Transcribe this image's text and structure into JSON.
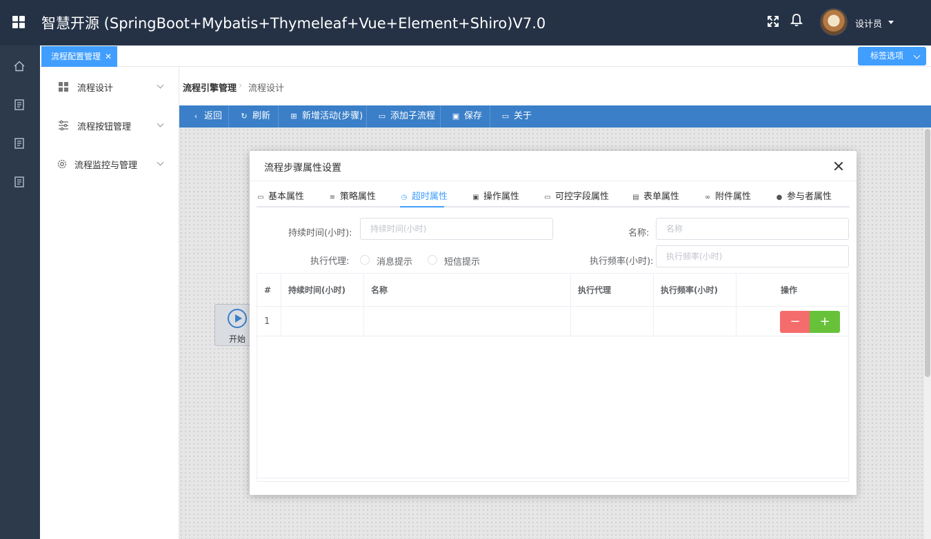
{
  "header": {
    "title": "智慧开源 (SpringBoot+Mybatis+Thymeleaf+Vue+Element+Shiro)V7.0",
    "user_name": "设计员"
  },
  "tabs_bar": {
    "active_tab": "流程配置管理",
    "close_glyph": "✕",
    "options_label": "标签选项"
  },
  "sidebar": {
    "items": [
      {
        "label": "流程设计",
        "icon": "grid-icon"
      },
      {
        "label": "流程按钮管理",
        "icon": "sliders-icon"
      },
      {
        "label": "流程监控与管理",
        "icon": "gear-icon"
      }
    ]
  },
  "breadcrumb": {
    "root": "流程引擎管理",
    "separator": "›",
    "current": "流程设计"
  },
  "toolbar": {
    "buttons": [
      {
        "label": "返回",
        "icon": "chevron-left-icon"
      },
      {
        "label": "刷新",
        "icon": "refresh-icon"
      },
      {
        "label": "新增活动(步骤)",
        "icon": "add-activity-icon"
      },
      {
        "label": "添加子流程",
        "icon": "folder-icon"
      },
      {
        "label": "保存",
        "icon": "save-icon"
      },
      {
        "label": "关于",
        "icon": "monitor-icon"
      }
    ]
  },
  "canvas": {
    "start_node_label": "开始"
  },
  "dialog": {
    "title": "流程步骤属性设置",
    "tabs": [
      {
        "label": "基本属性",
        "icon": "monitor-icon"
      },
      {
        "label": "策略属性",
        "icon": "sliders-icon"
      },
      {
        "label": "超时属性",
        "icon": "alarm-icon",
        "active": true
      },
      {
        "label": "操作属性",
        "icon": "save-icon"
      },
      {
        "label": "可控字段属性",
        "icon": "field-icon"
      },
      {
        "label": "表单属性",
        "icon": "document-icon"
      },
      {
        "label": "附件属性",
        "icon": "attachment-icon"
      },
      {
        "label": "参与者属性",
        "icon": "user-icon"
      }
    ],
    "form": {
      "duration_label": "持续时间(小时):",
      "duration_placeholder": "持续时间(小时)",
      "name_label": "名称:",
      "name_placeholder": "名称",
      "agent_label": "执行代理:",
      "agent_options": [
        "消息提示",
        "短信提示"
      ],
      "freq_label": "执行频率(小时):",
      "freq_placeholder": "执行频率(小时)"
    },
    "table": {
      "headers": [
        "#",
        "持续时间(小时)",
        "名称",
        "执行代理",
        "执行频率(小时)",
        "操作"
      ],
      "rows": [
        {
          "index": "1",
          "duration": "",
          "name": "",
          "agent": "",
          "freq": ""
        }
      ],
      "minus_label": "−",
      "plus_label": "+"
    }
  },
  "colors": {
    "header_bg": "#253246",
    "rail_bg": "#2d3a4b",
    "primary": "#409eff",
    "toolbar_bg": "#3a7fc8",
    "danger": "#f56c6c",
    "success": "#67c23a"
  }
}
